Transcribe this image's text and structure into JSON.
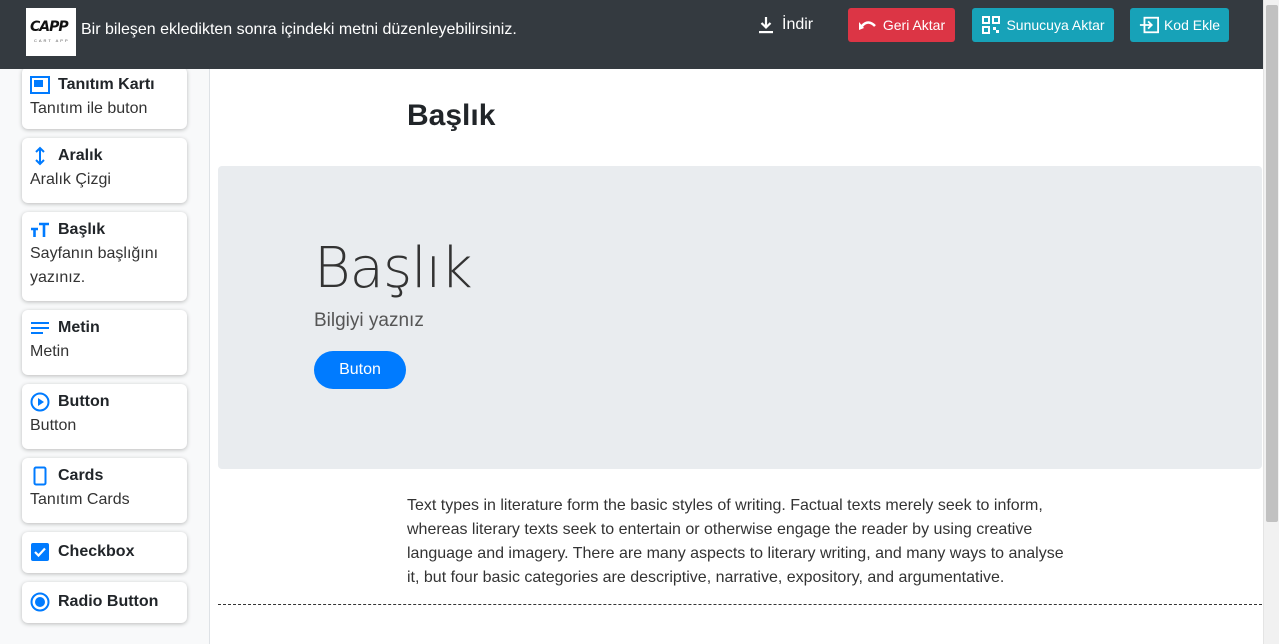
{
  "header": {
    "logo_text": "CAPP",
    "logo_subtext": "CART APP",
    "message": "Bir bileşen ekledikten sonra içindeki metni düzenleyebilirsiniz.",
    "download_label": "İndir",
    "undo_label": "Geri Aktar",
    "server_label": "Sunucuya Aktar",
    "code_label": "Kod Ekle"
  },
  "sidebar": {
    "items": [
      {
        "title": "Tanıtım Kartı",
        "desc": "Tanıtım ile buton",
        "icon": "intro-card-icon"
      },
      {
        "title": "Aralık",
        "desc": "Aralık Çizgi",
        "icon": "spacing-icon"
      },
      {
        "title": "Başlık",
        "desc": "Sayfanın başlığını yazınız.",
        "icon": "text-height-icon"
      },
      {
        "title": "Metin",
        "desc": "Metin",
        "icon": "text-lines-icon"
      },
      {
        "title": "Button",
        "desc": "Button",
        "icon": "play-circle-icon"
      },
      {
        "title": "Cards",
        "desc": "Tanıtım Cards",
        "icon": "card-icon"
      },
      {
        "title": "Checkbox",
        "desc": "",
        "icon": "checkbox-icon"
      },
      {
        "title": "Radio Button",
        "desc": "",
        "icon": "radio-icon"
      }
    ]
  },
  "main": {
    "title": "Başlık",
    "jumbotron": {
      "title": "Başlık",
      "text": "Bilgiyi yaznız",
      "button_label": "Buton"
    },
    "paragraph": "Text types in literature form the basic styles of writing. Factual texts merely seek to inform, whereas literary texts seek to entertain or otherwise engage the reader by using creative language and imagery. There are many aspects to literary writing, and many ways to analyse it, but four basic categories are descriptive, narrative, expository, and argumentative."
  },
  "colors": {
    "topbar": "#343a40",
    "danger": "#dc3545",
    "info": "#17a2b8",
    "primary": "#007bff",
    "jumbotron_bg": "#e9ecef"
  }
}
